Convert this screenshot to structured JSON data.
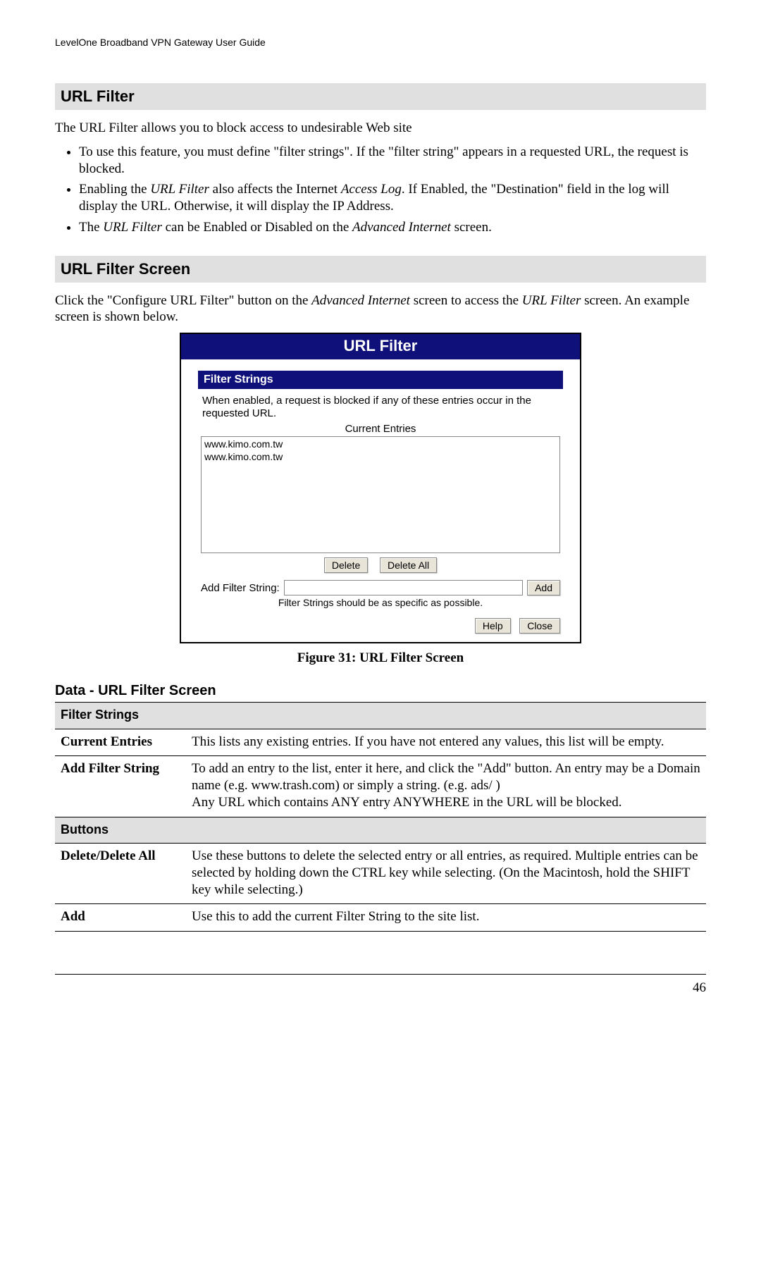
{
  "header": "LevelOne Broadband VPN Gateway User Guide",
  "section1": {
    "title": "URL Filter",
    "intro": "The URL Filter allows you to block access to undesirable Web site",
    "bullet1": "To use this feature, you must define \"filter strings\". If the \"filter string\" appears in a requested URL, the request is blocked.",
    "bullet2a": "Enabling the ",
    "bullet2b": "URL Filter",
    "bullet2c": " also affects the Internet ",
    "bullet2d": "Access Log",
    "bullet2e": ". If Enabled, the \"Destination\" field in the log will display the URL. Otherwise, it will display the IP Address.",
    "bullet3a": "The ",
    "bullet3b": "URL Filter",
    "bullet3c": " can be Enabled or Disabled on the ",
    "bullet3d": "Advanced Internet",
    "bullet3e": " screen."
  },
  "section2": {
    "title": "URL Filter Screen",
    "para_a": "Click the \"Configure URL Filter\" button on the ",
    "para_b": "Advanced Internet",
    "para_c": " screen to access the ",
    "para_d": "URL Filter",
    "para_e": " screen. An example screen is shown below."
  },
  "router": {
    "title": "URL Filter",
    "subhead": "Filter Strings",
    "desc": "When enabled, a request is blocked if any of these entries occur in the requested URL.",
    "current_entries_label": "Current Entries",
    "entries": [
      "www.kimo.com.tw",
      "www.kimo.com.tw"
    ],
    "delete": "Delete",
    "delete_all": "Delete All",
    "add_label": "Add Filter String:",
    "add_btn": "Add",
    "hint": "Filter Strings should be as specific as possible.",
    "help": "Help",
    "close": "Close"
  },
  "figure_caption": "Figure 31: URL Filter Screen",
  "data_heading": "Data - URL Filter Screen",
  "table": {
    "group1": "Filter Strings",
    "row1_label": "Current Entries",
    "row1_text": "This lists any existing entries. If you have not entered any values, this list will be empty.",
    "row2_label": "Add Filter String",
    "row2_text": "To add an entry to the list, enter it here, and click the \"Add\" button. An entry may be a Domain name (e.g. www.trash.com) or simply a string. (e.g. ads/ )\nAny URL which contains ANY entry ANYWHERE in the URL will be blocked.",
    "group2": "Buttons",
    "row3_label": "Delete/Delete All",
    "row3_text": "Use these buttons to delete the selected entry or all entries, as required. Multiple entries can be selected by holding down the CTRL key while selecting. (On the Macintosh, hold the SHIFT key while selecting.)",
    "row4_label": "Add",
    "row4_text": "Use this to add the current Filter String to the site list."
  },
  "page_number": "46"
}
